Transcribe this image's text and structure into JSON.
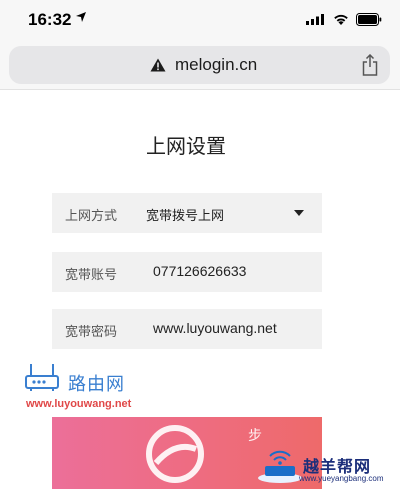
{
  "status_bar": {
    "time": "16:32"
  },
  "browser": {
    "url": "melogin.cn"
  },
  "page": {
    "title": "上网设置",
    "fields": [
      {
        "label": "上网方式",
        "value": "宽带拨号上网"
      },
      {
        "label": "宽带账号",
        "value": "077126626633"
      },
      {
        "label": "宽带密码",
        "value": "www.luyouwang.net"
      }
    ],
    "button_label": "步"
  },
  "watermarks": {
    "luyouwang": {
      "brand": "路由网",
      "site": "www.luyouwang.net"
    },
    "yueyangbang": {
      "brand": "越羊帮网",
      "site": "www.yueyangbang.com"
    }
  },
  "colors": {
    "button_gradient_start": "#ec6f99",
    "button_gradient_end": "#ee6a6a",
    "field_bg": "#f1f1f1",
    "urlbar_bg": "#e6e6e8"
  }
}
